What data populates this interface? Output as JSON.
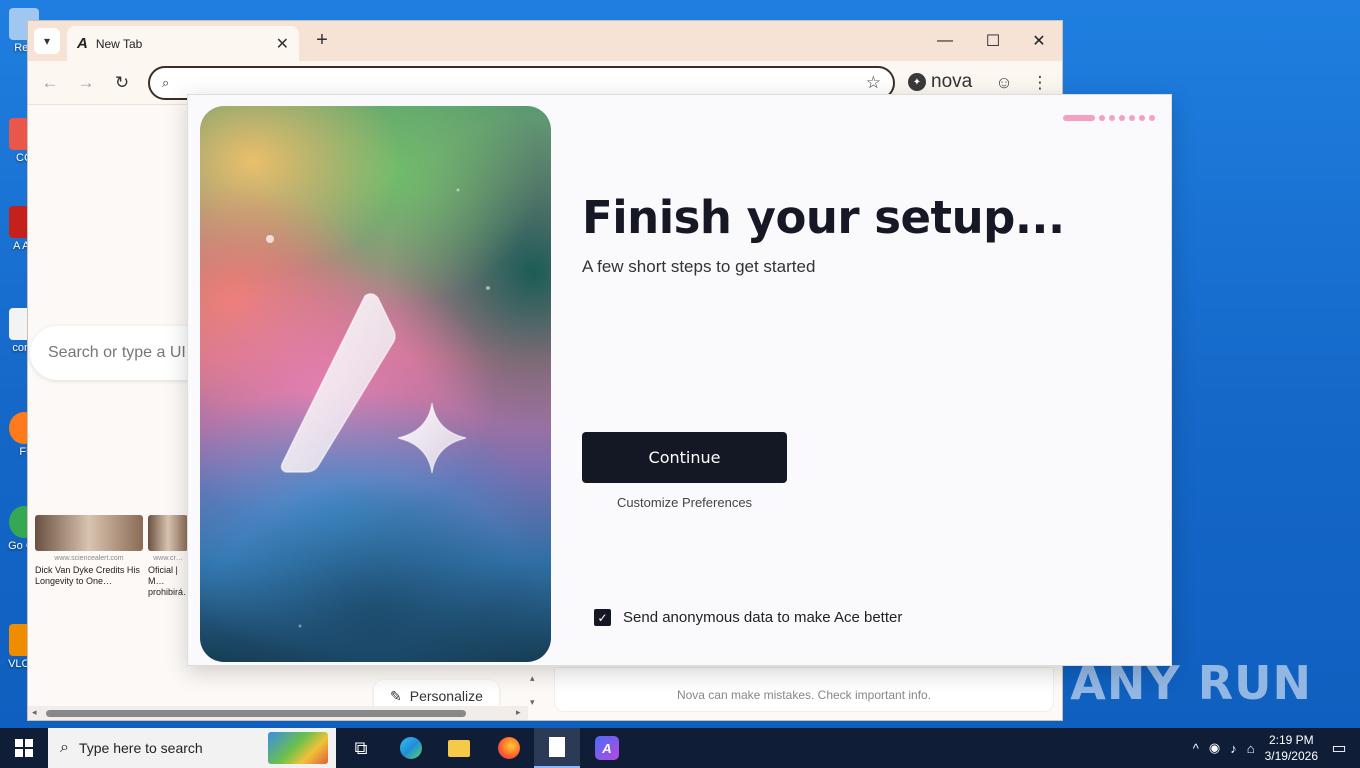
{
  "desktop": {
    "icons": [
      {
        "label": "Rec",
        "color": "#9fc7ef"
      },
      {
        "label": "CC",
        "color": "#e9574a"
      },
      {
        "label": "A Ac",
        "color": "#c4201c"
      },
      {
        "label": "cons",
        "color": "#f3f3f3"
      },
      {
        "label": "Fi",
        "color": "#ff7a1a"
      },
      {
        "label": "Go Ch",
        "color": "#34a853"
      },
      {
        "label": "VLC P",
        "color": "#f08c00"
      }
    ],
    "watermark": "ANY RUN"
  },
  "browser": {
    "tab": {
      "logo": "A",
      "title": "New Tab"
    },
    "new_tab_symbol": "+",
    "window_controls": {
      "minimize": "—",
      "maximize": "☐",
      "close": "✕"
    },
    "omnibox": {
      "value": "",
      "placeholder": ""
    },
    "nova_label": "nova",
    "page": {
      "search_placeholder": "Search or type a UI",
      "news": [
        {
          "source": "www.sciencealert.com",
          "title": "Dick Van Dyke Credits His Longevity to One…"
        },
        {
          "source": "www.cr…",
          "title": "Oficial | M… prohibirá…"
        }
      ],
      "personalize_label": "Personalize",
      "disclaimer": "Nova can make mistakes. Check important info."
    }
  },
  "onboarding": {
    "progress": {
      "current_step": 1,
      "total_steps": 8
    },
    "headline": "Finish your setup...",
    "subheadline": "A few short steps to get started",
    "continue_label": "Continue",
    "customize_label": "Customize Preferences",
    "consent_label": "Send anonymous data to make Ace better",
    "consent_checked": true
  },
  "taskbar": {
    "search_placeholder": "Type here to search",
    "clock_time": "2:19 PM",
    "clock_date": "3/19/2026"
  }
}
